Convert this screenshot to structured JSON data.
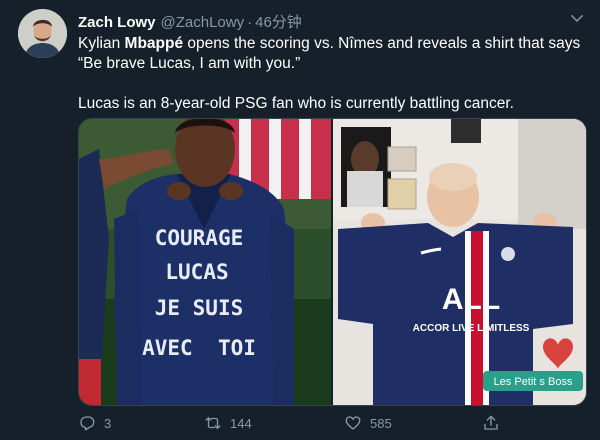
{
  "tweet": {
    "author_name": "Zach Lowy",
    "author_handle": "@ZachLowy",
    "separator": "·",
    "time": "46分钟",
    "line1_pre": "Kylian ",
    "line1_bold": "Mbappé",
    "line1_post": " opens the scoring vs. Nîmes and reveals a shirt that says “Be brave Lucas, I am with you.”",
    "line2": "Lucas is an 8-year-old PSG fan who is currently battling cancer."
  },
  "media": {
    "left": {
      "shirt_text": [
        "COURAGE",
        "LUCAS",
        "JE SUIS",
        "AVEC  TOI"
      ]
    },
    "right": {
      "sponsor_line1": "ALL",
      "sponsor_line2": "ACCOR LIVE LIMITLESS",
      "watermark": "Les Petit s Boss"
    }
  },
  "actions": {
    "reply_count": "3",
    "retweet_count": "144",
    "like_count": "585"
  },
  "colors": {
    "background": "#15202b",
    "secondary_text": "#8899a6",
    "border": "#38444d"
  }
}
